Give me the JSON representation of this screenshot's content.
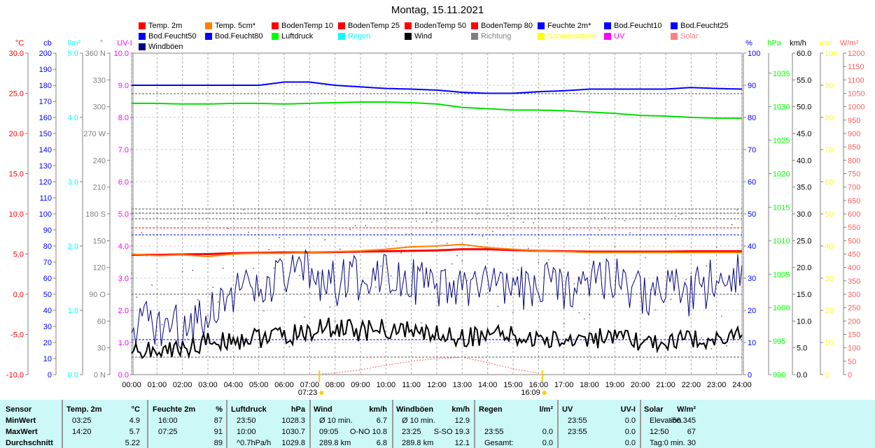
{
  "title": "Montag, 15.11.2021",
  "legend": [
    {
      "label": "Temp. 2m",
      "color": "#ff0000"
    },
    {
      "label": "Temp. 5cm*",
      "color": "#ff8000"
    },
    {
      "label": "BodenTemp 10",
      "color": "#ff0000"
    },
    {
      "label": "BodenTemp 25",
      "color": "#ff0000"
    },
    {
      "label": "BodenTemp 50",
      "color": "#ff0000"
    },
    {
      "label": "BodenTemp 80",
      "color": "#ff0000"
    },
    {
      "label": "Feuchte 2m*",
      "color": "#0000ff"
    },
    {
      "label": "Bod.Feucht10",
      "color": "#0000ff"
    },
    {
      "label": "Bod.Feucht25",
      "color": "#0000ff"
    },
    {
      "label": "Bod.Feucht50",
      "color": "#0000ff"
    },
    {
      "label": "Bod.Feucht80",
      "color": "#0000ff"
    },
    {
      "label": "Luftdruck",
      "color": "#00ff00"
    },
    {
      "label": "Regen",
      "color": "#00ffff"
    },
    {
      "label": "Wind",
      "color": "#000000"
    },
    {
      "label": "Richtung",
      "color": "#808080"
    },
    {
      "label": "Sonnenschein",
      "color": "#ffff00"
    },
    {
      "label": "UV",
      "color": "#ff00ff"
    },
    {
      "label": "Solar",
      "color": "#ff8080"
    },
    {
      "label": "Windböen",
      "color": "#000080"
    }
  ],
  "axes": {
    "left": [
      {
        "unit": "°C",
        "color": "#ff0000",
        "min": -10,
        "max": 30,
        "step": 5,
        "dec": 1
      },
      {
        "unit": "cb",
        "color": "#0000ff",
        "min": 0,
        "max": 200,
        "step": 10,
        "dec": 0
      },
      {
        "unit": "l/m²",
        "color": "#00ffff",
        "min": 0,
        "max": 5,
        "step": 1,
        "dec": 1
      },
      {
        "unit": "°",
        "color": "#808080",
        "min": 0,
        "max": 360,
        "step": 30,
        "dec": 0,
        "compass": {
          "0": "N",
          "90": "O",
          "180": "S",
          "270": "W",
          "360": "N"
        }
      },
      {
        "unit": "UV-I",
        "color": "#ff00ff",
        "min": 0,
        "max": 10,
        "step": 1,
        "dec": 1
      }
    ],
    "right": [
      {
        "unit": "%",
        "color": "#0000ff",
        "min": 0,
        "max": 100,
        "step": 10,
        "dec": 0
      },
      {
        "unit": "hPa",
        "color": "#00ff00",
        "min": 990,
        "max": 1038,
        "step": 5,
        "dec": 0
      },
      {
        "unit": "km/h",
        "color": "#000000",
        "min": 0,
        "max": 60,
        "step": 5,
        "dec": 1
      },
      {
        "unit": "min",
        "color": "#ffff00",
        "min": 0,
        "max": 100,
        "step": 10,
        "dec": 0
      },
      {
        "unit": "W/m²",
        "color": "#ff6060",
        "min": 0,
        "max": 1200,
        "step": 50,
        "dec": 0
      }
    ]
  },
  "time_labels": [
    "00:00",
    "01:00",
    "02:00",
    "03:00",
    "04:00",
    "05:00",
    "06:00",
    "07:00",
    "08:00",
    "09:00",
    "10:00",
    "11:00",
    "12:00",
    "13:00",
    "14:00",
    "15:00",
    "16:00",
    "17:00",
    "18:00",
    "19:00",
    "20:00",
    "21:00",
    "22:00",
    "23:00",
    "24:00"
  ],
  "sunrise": "07:23",
  "sunset": "16:09",
  "chart_data": {
    "type": "line",
    "title": "Montag, 15.11.2021",
    "x_hours": [
      0,
      1,
      2,
      3,
      4,
      5,
      6,
      7,
      8,
      9,
      10,
      11,
      12,
      13,
      14,
      15,
      16,
      17,
      18,
      19,
      20,
      21,
      22,
      23,
      24
    ],
    "series": [
      {
        "name": "Temp. 2m",
        "axis": "°C",
        "color": "#ff0000",
        "width": 3,
        "values": [
          4.9,
          4.9,
          4.95,
          5.0,
          5.1,
          5.15,
          5.2,
          5.2,
          5.25,
          5.3,
          5.35,
          5.4,
          5.45,
          5.6,
          5.6,
          5.5,
          5.4,
          5.35,
          5.3,
          5.3,
          5.3,
          5.3,
          5.35,
          5.35,
          5.35
        ]
      },
      {
        "name": "Temp. 5cm*",
        "axis": "°C",
        "color": "#ff8000",
        "width": 2,
        "values": [
          5.0,
          4.8,
          4.9,
          4.7,
          5.0,
          5.1,
          5.1,
          5.2,
          5.3,
          5.4,
          5.6,
          5.9,
          6.0,
          6.2,
          5.8,
          5.6,
          5.4,
          5.3,
          5.2,
          5.2,
          5.2,
          5.2,
          5.2,
          5.2,
          5.2
        ]
      },
      {
        "name": "Feuchte 2m*",
        "axis": "%",
        "color": "#0000ff",
        "width": 2,
        "values": [
          90,
          90,
          90,
          90,
          90,
          90,
          91,
          91,
          90,
          89.5,
          89,
          88.8,
          88.5,
          87.8,
          87.5,
          87.5,
          88,
          88.3,
          88.8,
          88.8,
          88.8,
          88.8,
          89.3,
          89,
          88.8
        ]
      },
      {
        "name": "Luftdruck",
        "axis": "hPa",
        "color": "#00dd00",
        "width": 2,
        "values": [
          1030.5,
          1030.5,
          1030.4,
          1030.4,
          1030.5,
          1030.5,
          1030.4,
          1030.5,
          1030.6,
          1030.7,
          1030.7,
          1030.6,
          1030.4,
          1029.9,
          1029.7,
          1029.5,
          1029.5,
          1029.4,
          1029.2,
          1029.0,
          1028.7,
          1028.6,
          1028.4,
          1028.3,
          1028.3
        ]
      },
      {
        "name": "Windböen",
        "axis": "km/h",
        "color": "#000080",
        "width": 1,
        "values": [
          10,
          9,
          9,
          12,
          16,
          15,
          18,
          19,
          17,
          18,
          20,
          18,
          15,
          16,
          17,
          15,
          17,
          16,
          19,
          18,
          15,
          16,
          15,
          18,
          20
        ]
      },
      {
        "name": "Wind",
        "axis": "km/h",
        "color": "#000000",
        "width": 2,
        "values": [
          5,
          4,
          5,
          6,
          6.5,
          7,
          7,
          8,
          9,
          8,
          8.5,
          8,
          7.5,
          7,
          7.5,
          7,
          6.5,
          6.5,
          7,
          6.5,
          6,
          6,
          6.5,
          7,
          7
        ]
      },
      {
        "name": "Solar",
        "axis": "W/m²",
        "color": "#ff6060",
        "width": 1,
        "values": [
          0,
          0,
          0,
          0,
          0,
          0,
          0,
          0,
          6,
          18,
          35,
          50,
          60,
          65,
          45,
          22,
          5,
          0,
          0,
          0,
          0,
          0,
          0,
          0,
          0
        ]
      }
    ]
  },
  "table": {
    "headers": [
      [
        "Sensor",
        ""
      ],
      [
        "Temp. 2m",
        "°C"
      ],
      [
        "Feuchte 2m",
        "%"
      ],
      [
        "Luftdruck",
        "hPa"
      ],
      [
        "Wind",
        "km/h"
      ],
      [
        "Windböen",
        "km/h"
      ],
      [
        "Regen",
        "l/m²"
      ],
      [
        "UV",
        "UV-I"
      ],
      [
        "Solar",
        "W/m²"
      ]
    ],
    "rows": [
      [
        [
          "MinWert"
        ],
        [
          "03:25",
          "4.9"
        ],
        [
          "16:00",
          "87"
        ],
        [
          "23:50",
          "1028.3"
        ],
        [
          "Ø 10 min.",
          "6.7"
        ],
        [
          "Ø 10 min.",
          "12.9"
        ],
        [
          "",
          ""
        ],
        [
          "23:55",
          "0.0"
        ],
        [
          "Elevation",
          "-56.345"
        ]
      ],
      [
        [
          "MaxWert"
        ],
        [
          "14:20",
          "5.7"
        ],
        [
          "07:25",
          "91"
        ],
        [
          "10:00",
          "1030.7"
        ],
        [
          "09:05",
          "O-NO 10.8"
        ],
        [
          "23:25",
          "S-SO 19.3"
        ],
        [
          "23:55",
          "0.0"
        ],
        [
          "23:55",
          "0.0"
        ],
        [
          "12:50",
          "67"
        ]
      ],
      [
        [
          "Durchschnitt"
        ],
        [
          "",
          "5.22"
        ],
        [
          "",
          "89"
        ],
        [
          "^0.7hPa/h",
          "1029.8"
        ],
        [
          "289.8 km",
          "6.8"
        ],
        [
          "289.8 km",
          "12.1"
        ],
        [
          "Gesamt:",
          "0.0"
        ],
        [
          "",
          "0.0"
        ],
        [
          "Tag:0 min.",
          "30"
        ]
      ]
    ]
  }
}
